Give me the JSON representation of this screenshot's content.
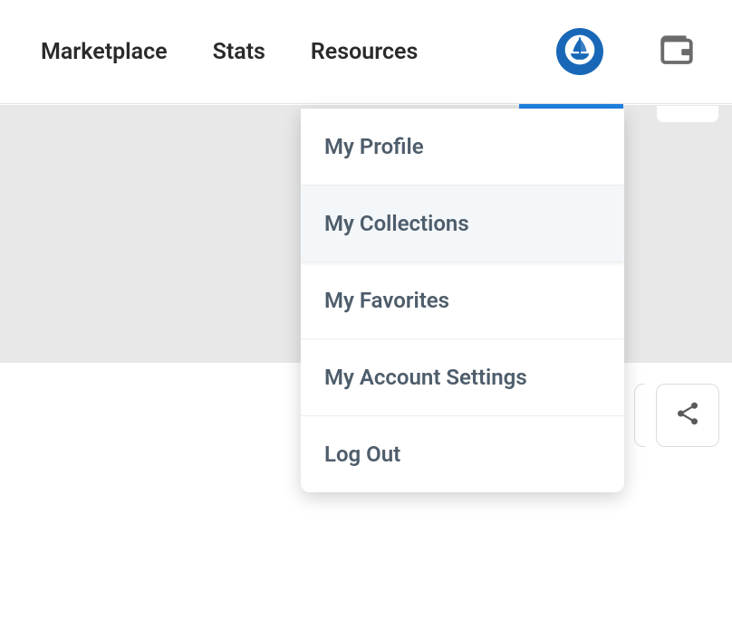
{
  "nav": {
    "marketplace": "Marketplace",
    "stats": "Stats",
    "resources": "Resources"
  },
  "dropdown": {
    "items": [
      {
        "label": "My Profile",
        "hovered": false
      },
      {
        "label": "My Collections",
        "hovered": true
      },
      {
        "label": "My Favorites",
        "hovered": false
      },
      {
        "label": "My Account Settings",
        "hovered": false
      },
      {
        "label": "Log Out",
        "hovered": false
      }
    ]
  },
  "colors": {
    "accent": "#2081e2",
    "avatar": "#1868b7"
  }
}
